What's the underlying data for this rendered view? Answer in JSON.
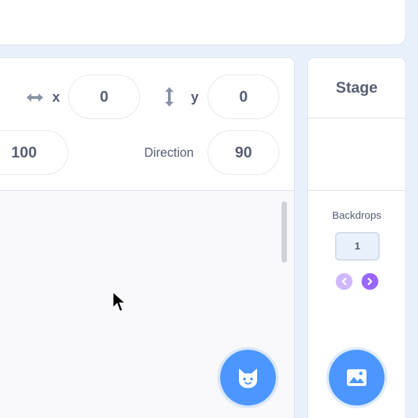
{
  "sprite_info": {
    "x_label": "x",
    "x_value": "0",
    "y_label": "y",
    "y_value": "0",
    "size_value": "100",
    "direction_label": "Direction",
    "direction_value": "90"
  },
  "stage_panel": {
    "title": "Stage",
    "backdrops_label": "Backdrops",
    "backdrop_count": "1"
  },
  "icons": {
    "x_arrows": "horizontal-arrows-icon",
    "y_arrows": "vertical-arrows-icon",
    "choose_sprite": "cat-icon",
    "choose_backdrop": "image-icon",
    "prev": "chevron-left-icon",
    "next": "chevron-right-icon"
  },
  "colors": {
    "accent": "#4c97ff",
    "text": "#575e75",
    "nav_next": "#9966ff",
    "nav_prev": "#cfb8ff",
    "background": "#e9f1fc"
  }
}
